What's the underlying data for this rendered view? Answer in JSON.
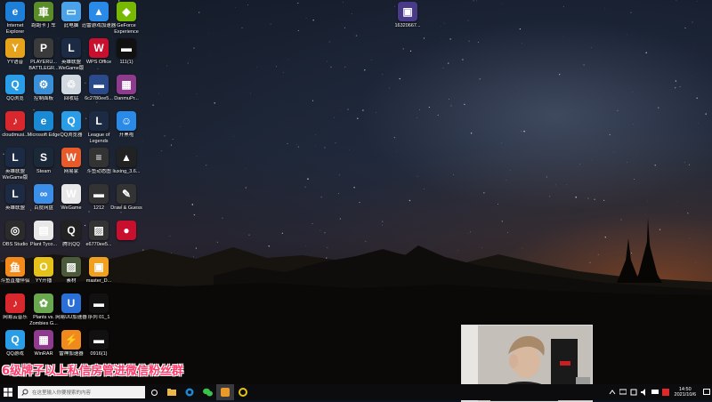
{
  "desktop": {
    "icons": [
      {
        "label": "Internet Explorer",
        "icon": "ie-icon",
        "color": "#1e7fd8",
        "glyph": "e"
      },
      {
        "label": "YY语音",
        "icon": "yy-icon",
        "color": "#e5a21a",
        "glyph": "Y"
      },
      {
        "label": "QQ浏览",
        "icon": "qq-icon",
        "color": "#2a9de8",
        "glyph": "Q"
      },
      {
        "label": "cloudmusi...",
        "icon": "netease-music-icon",
        "color": "#d9272e",
        "glyph": "♪"
      },
      {
        "label": "英雄联盟 WeGame版",
        "icon": "lol-icon",
        "color": "#1c2a44",
        "glyph": "L"
      },
      {
        "label": "英雄联盟",
        "icon": "lol-icon",
        "color": "#1c2a44",
        "glyph": "L"
      },
      {
        "label": "OBS Studio",
        "icon": "obs-icon",
        "color": "#2b2b2b",
        "glyph": "◎"
      },
      {
        "label": "斗鱼直播伴侣",
        "icon": "douyu-icon",
        "color": "#f38b1c",
        "glyph": "鱼"
      },
      {
        "label": "网易云音乐",
        "icon": "netease-music-icon",
        "color": "#d9272e",
        "glyph": "♪"
      },
      {
        "label": "QQ游戏",
        "icon": "qq-game-icon",
        "color": "#2a9de8",
        "glyph": "Q"
      },
      {
        "label": "跑跑卡丁车",
        "icon": "game-icon",
        "color": "#5a8c2a",
        "glyph": "車"
      },
      {
        "label": "PLAYERU... BATTLEGR...",
        "icon": "pubg-icon",
        "color": "#3a3a3a",
        "glyph": "P"
      },
      {
        "label": "控制面板",
        "icon": "control-panel-icon",
        "color": "#3b8fd6",
        "glyph": "⚙"
      },
      {
        "label": "Microsoft Edge",
        "icon": "edge-icon",
        "color": "#1a8ad4",
        "glyph": "e"
      },
      {
        "label": "Steam",
        "icon": "steam-icon",
        "color": "#1b2838",
        "glyph": "S"
      },
      {
        "label": "百度网盘",
        "icon": "baidu-netdisk-icon",
        "color": "#3b8fe8",
        "glyph": "∞"
      },
      {
        "label": "Plant Tyco...",
        "icon": "file-icon",
        "color": "#e8e8e8",
        "glyph": "▤"
      },
      {
        "label": "YY开播",
        "icon": "yy-live-icon",
        "color": "#e5c21a",
        "glyph": "O"
      },
      {
        "label": "Plants vs. Zombies G...",
        "icon": "pvz-icon",
        "color": "#6aa84f",
        "glyph": "✿"
      },
      {
        "label": "WinRAR",
        "icon": "winrar-icon",
        "color": "#8e3b8e",
        "glyph": "▦"
      },
      {
        "label": "此电脑",
        "icon": "computer-icon",
        "color": "#4aa3e8",
        "glyph": "▭"
      },
      {
        "label": "英雄联盟 WeGame版",
        "icon": "lol-icon",
        "color": "#1c2a44",
        "glyph": "L"
      },
      {
        "label": "回收站",
        "icon": "recycle-bin-icon",
        "color": "#d0d8e0",
        "glyph": "♲"
      },
      {
        "label": "QQ浏览器",
        "icon": "qq-browser-icon",
        "color": "#2a9de8",
        "glyph": "Q"
      },
      {
        "label": "网易家",
        "icon": "netease-icon",
        "color": "#e85a2a",
        "glyph": "W"
      },
      {
        "label": "WeGame",
        "icon": "wegame-icon",
        "color": "#e8e8e8",
        "glyph": "W"
      },
      {
        "label": "腾讯QQ",
        "icon": "qq-penguin-icon",
        "color": "#222",
        "glyph": "Q"
      },
      {
        "label": "素材",
        "icon": "image-icon",
        "color": "#4b5a3a",
        "glyph": "▨"
      },
      {
        "label": "网易UU加速器",
        "icon": "uu-icon",
        "color": "#2a6fd8",
        "glyph": "U"
      },
      {
        "label": "雷神加速器",
        "icon": "leishen-icon",
        "color": "#f08a1c",
        "glyph": "⚡"
      },
      {
        "label": "迅雷游戏加速器",
        "icon": "xunlei-icon",
        "color": "#2a8ae8",
        "glyph": "▲"
      },
      {
        "label": "WPS Office",
        "icon": "wps-icon",
        "color": "#c8102e",
        "glyph": "W"
      },
      {
        "label": "6c2780ee5...",
        "icon": "file-icon",
        "color": "#2a4a8a",
        "glyph": "▬"
      },
      {
        "label": "League of Legends",
        "icon": "lol-icon",
        "color": "#1c2a44",
        "glyph": "L"
      },
      {
        "label": "斗鱼动态图",
        "icon": "douyu-icon",
        "color": "#333",
        "glyph": "≡"
      },
      {
        "label": "1212",
        "icon": "file-icon",
        "color": "#333",
        "glyph": "▬"
      },
      {
        "label": "e6770ee5...",
        "icon": "image-icon",
        "color": "#333",
        "glyph": "▨"
      },
      {
        "label": "master_D...",
        "icon": "folder-icon",
        "color": "#f0a020",
        "glyph": "▣"
      },
      {
        "label": "序列 01_1",
        "icon": "video-icon",
        "color": "#111",
        "glyph": "▬"
      },
      {
        "label": "0916(1)",
        "icon": "video-icon",
        "color": "#111",
        "glyph": "▬"
      },
      {
        "label": "GeForce Experience",
        "icon": "geforce-icon",
        "color": "#76b900",
        "glyph": "◆"
      },
      {
        "label": "111(1)",
        "icon": "video-icon",
        "color": "#111",
        "glyph": "▬"
      },
      {
        "label": "DanmuPr...",
        "icon": "file-icon",
        "color": "#8e3b8e",
        "glyph": "▦"
      },
      {
        "label": "开黑啦",
        "icon": "kaiheila-icon",
        "color": "#2a8ae8",
        "glyph": "☺"
      },
      {
        "label": "liuxing_3.6...",
        "icon": "file-icon",
        "color": "#222",
        "glyph": "▲"
      },
      {
        "label": "Draw & Guess",
        "icon": "draw-guess-icon",
        "color": "#333",
        "glyph": "✎"
      },
      {
        "label": "",
        "icon": "app-icon",
        "color": "#c8102e",
        "glyph": "●"
      },
      {
        "label": "16320667...",
        "icon": "image-icon",
        "color": "#4a3a8a",
        "glyph": "▣"
      }
    ]
  },
  "overlay": {
    "text": "6级牌子以上私信房管进微信粉丝群"
  },
  "taskbar": {
    "search_placeholder": "在这里输入你要搜索的内容",
    "clock_time": "14:50",
    "clock_date": "2021/10/6"
  }
}
